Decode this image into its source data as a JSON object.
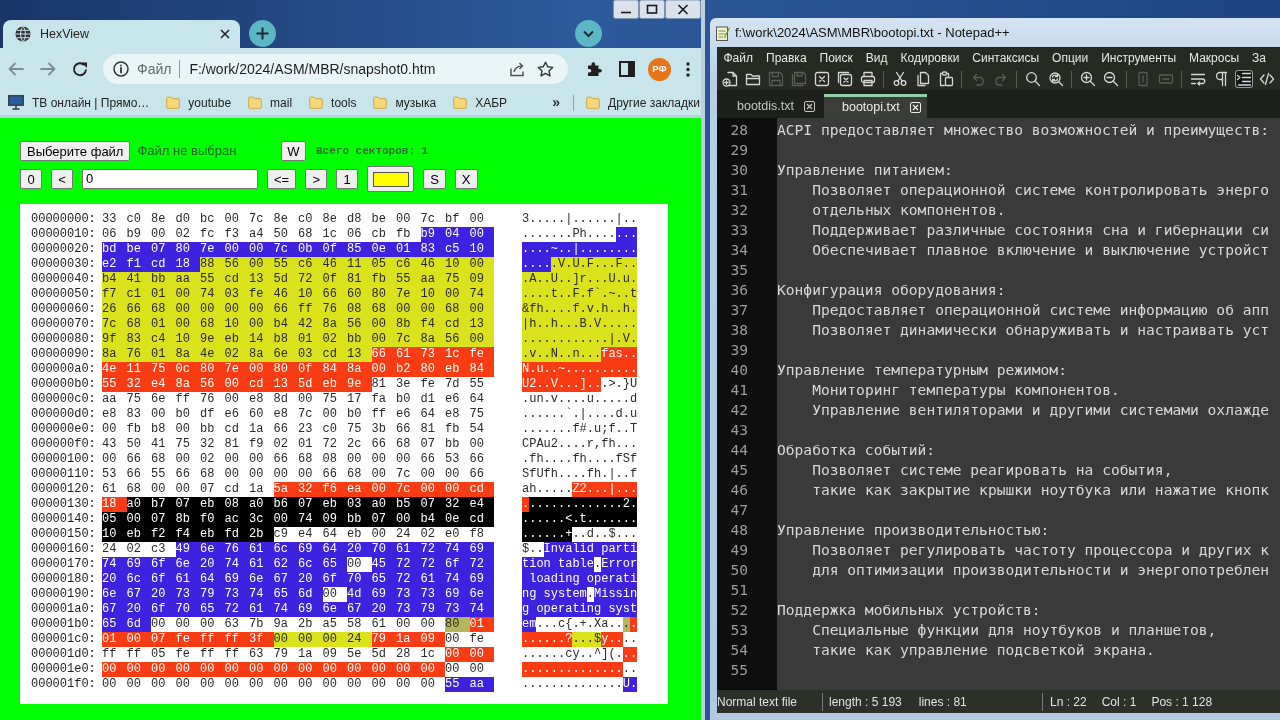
{
  "browser": {
    "tabs": [
      {
        "title": "HexView",
        "selected": true
      }
    ],
    "address_bar": {
      "scheme": "Файл",
      "url": "F:/work/2024/ASM/MBR/snapshot0.htm"
    },
    "profile": {
      "initials": "РФ"
    },
    "bookmarks": [
      {
        "kind": "site",
        "label": "ТВ онлайн | Прямо…"
      },
      {
        "kind": "folder",
        "label": "youtube"
      },
      {
        "kind": "folder",
        "label": "mail"
      },
      {
        "kind": "folder",
        "label": "tools"
      },
      {
        "kind": "folder",
        "label": "музыка"
      },
      {
        "kind": "folder",
        "label": "ХАБР"
      }
    ],
    "bookmarks_overflow": "»",
    "other_bookmarks": {
      "kind": "folder",
      "label": "Другие закладки"
    }
  },
  "hexview": {
    "file_button": "Выберите файл",
    "file_status": "Файл не выбран",
    "w_button": "W",
    "sector_count": "Всего секторов: 1",
    "controls": [
      {
        "kind": "button",
        "label": "0"
      },
      {
        "kind": "button",
        "label": "<"
      },
      {
        "kind": "input",
        "value": "0"
      },
      {
        "kind": "button",
        "label": "<="
      },
      {
        "kind": "button",
        "label": ">"
      },
      {
        "kind": "button",
        "label": "1"
      },
      {
        "kind": "color",
        "color": "#ffff00"
      },
      {
        "kind": "button",
        "label": "S"
      },
      {
        "kind": "button",
        "label": "X"
      }
    ],
    "dump": {
      "rows": [
        {
          "offset": "00000000:",
          "segments": [
            {
              "bytes": "33 c0 8e d0 bc 00 7c 8e c0 8e d8 be 00 7c bf 00",
              "color": "#ffffff"
            }
          ],
          "ascii": "3.....|......|.."
        },
        {
          "offset": "00000010:",
          "segments": [
            {
              "bytes": "06 b9 00 02 fc f3 a4 50 68 1c 06 cb fb",
              "color": "#ffffff"
            },
            {
              "bytes": "b9 04 00",
              "color": "#3d22e0"
            }
          ],
          "ascii": ".......Ph......."
        },
        {
          "offset": "00000020:",
          "segments": [
            {
              "bytes": "bd be 07 80 7e 00 00 7c 0b 0f 85 0e 01 83 c5 10",
              "color": "#3d22e0"
            }
          ],
          "ascii": "....~..|........"
        },
        {
          "offset": "00000030:",
          "segments": [
            {
              "bytes": "e2 f1 cd 18",
              "color": "#3d22e0"
            },
            {
              "bytes": "88 56 00 55 c6 46 11 05 c6 46 10 00",
              "color": "#dbe21c"
            }
          ],
          "ascii": ".....V.U.F...F.."
        },
        {
          "offset": "00000040:",
          "segments": [
            {
              "bytes": "b4 41 bb aa 55 cd 13 5d 72 0f 81 fb 55 aa 75 09",
              "color": "#dbe21c"
            }
          ],
          "ascii": ".A..U..]r...U.u."
        },
        {
          "offset": "00000050:",
          "segments": [
            {
              "bytes": "f7 c1 01 00 74 03 fe 46 10 66 60 80 7e 10 00 74",
              "color": "#dbe21c"
            }
          ],
          "ascii": "....t..F.f`.~..t"
        },
        {
          "offset": "00000060:",
          "segments": [
            {
              "bytes": "26 66 68 00 00 00 00 66 ff 76 08 68 00 00 68 00",
              "color": "#dbe21c"
            }
          ],
          "ascii": "&fh....f.v.h..h."
        },
        {
          "offset": "00000070:",
          "segments": [
            {
              "bytes": "7c 68 01 00 68 10 00 b4 42 8a 56 00 8b f4 cd 13",
              "color": "#dbe21c"
            }
          ],
          "ascii": "|h..h...B.V....."
        },
        {
          "offset": "00000080:",
          "segments": [
            {
              "bytes": "9f 83 c4 10 9e eb 14 b8 01 02 bb 00 7c 8a 56 00",
              "color": "#dbe21c"
            }
          ],
          "ascii": "............|.V."
        },
        {
          "offset": "00000090:",
          "segments": [
            {
              "bytes": "8a 76 01 8a 4e 02 8a 6e 03 cd 13",
              "color": "#dbe21c"
            },
            {
              "bytes": "66 61 73 1c fe",
              "color": "#fa3c14"
            }
          ],
          "ascii": ".v..N..n...fas.."
        },
        {
          "offset": "000000a0:",
          "segments": [
            {
              "bytes": "4e 11 75 0c 80 7e 00 80 0f 84 8a 00 b2 80 eb 84",
              "color": "#fa3c14"
            }
          ],
          "ascii": "N.u..~.........."
        },
        {
          "offset": "000000b0:",
          "segments": [
            {
              "bytes": "55 32 e4 8a 56 00 cd 13 5d eb 9e",
              "color": "#fa3c14"
            },
            {
              "bytes": "81 3e fe 7d 55",
              "color": "#ffffff"
            }
          ],
          "ascii": "U2..V...]...>.}U"
        },
        {
          "offset": "000000c0:",
          "segments": [
            {
              "bytes": "aa 75 6e ff 76 00 e8 8d 00 75 17 fa b0 d1 e6 64",
              "color": "#ffffff"
            }
          ],
          "ascii": ".un.v....u.....d"
        },
        {
          "offset": "000000d0:",
          "segments": [
            {
              "bytes": "e8 83 00 b0 df e6 60 e8 7c 00 b0 ff e6 64 e8 75",
              "color": "#ffffff"
            }
          ],
          "ascii": "......`.|....d.u"
        },
        {
          "offset": "000000e0:",
          "segments": [
            {
              "bytes": "00 fb b8 00 bb cd 1a 66 23 c0 75 3b 66 81 fb 54",
              "color": "#ffffff"
            }
          ],
          "ascii": ".......f#.u;f..T"
        },
        {
          "offset": "000000f0:",
          "segments": [
            {
              "bytes": "43 50 41 75 32 81 f9 02 01 72 2c 66 68 07 bb 00",
              "color": "#ffffff"
            }
          ],
          "ascii": "CPAu2....r,fh..."
        },
        {
          "offset": "00000100:",
          "segments": [
            {
              "bytes": "00 66 68 00 02 00 00 66 68 08 00 00 00 66 53 66",
              "color": "#ffffff"
            }
          ],
          "ascii": ".fh....fh....fSf"
        },
        {
          "offset": "00000110:",
          "segments": [
            {
              "bytes": "53 66 55 66 68 00 00 00 00 66 68 00 7c 00 00 66",
              "color": "#ffffff"
            }
          ],
          "ascii": "SfUfh....fh.|..f"
        },
        {
          "offset": "00000120:",
          "segments": [
            {
              "bytes": "61 68 00 00 07 cd 1a",
              "color": "#ffffff"
            },
            {
              "bytes": "5a 32 f6 ea 00 7c 00 00 cd",
              "color": "#fa3c14"
            }
          ],
          "ascii": "ah.....Z2...|..."
        },
        {
          "offset": "00000130:",
          "segments": [
            {
              "bytes": "18",
              "color": "#fa3c14"
            },
            {
              "bytes": "a0 b7 07 eb 08 a0 b6 07 eb 03 a0 b5 07 32 e4",
              "color": "#000000"
            }
          ],
          "ascii": "..............2."
        },
        {
          "offset": "00000140:",
          "segments": [
            {
              "bytes": "05 00 07 8b f0 ac 3c 00 74 09 bb 07 00 b4 0e cd",
              "color": "#000000"
            }
          ],
          "ascii": "......<.t......."
        },
        {
          "offset": "00000150:",
          "segments": [
            {
              "bytes": "10 eb f2 f4 eb fd 2b",
              "color": "#000000"
            },
            {
              "bytes": "c9 e4 64 eb 00 24 02 e0 f8",
              "color": "#ffffff"
            }
          ],
          "ascii": "......+..d..$..."
        },
        {
          "offset": "00000160:",
          "segments": [
            {
              "bytes": "24 02 c3",
              "color": "#ffffff"
            },
            {
              "bytes": "49 6e 76 61 6c 69 64 20 70 61 72 74 69",
              "color": "#3d22e0"
            }
          ],
          "ascii": "$..Invalid parti"
        },
        {
          "offset": "00000170:",
          "segments": [
            {
              "bytes": "74 69 6f 6e 20 74 61 62 6c 65",
              "color": "#3d22e0"
            },
            {
              "bytes": "00",
              "color": "#ffffff"
            },
            {
              "bytes": "45 72 72 6f 72",
              "color": "#3d22e0"
            }
          ],
          "ascii": "tion table.Error"
        },
        {
          "offset": "00000180:",
          "segments": [
            {
              "bytes": "20 6c 6f 61 64 69 6e 67 20 6f 70 65 72 61 74 69",
              "color": "#3d22e0"
            }
          ],
          "ascii": " loading operati"
        },
        {
          "offset": "00000190:",
          "segments": [
            {
              "bytes": "6e 67 20 73 79 73 74 65 6d",
              "color": "#3d22e0"
            },
            {
              "bytes": "00",
              "color": "#ffffff"
            },
            {
              "bytes": "4d 69 73 73 69 6e",
              "color": "#3d22e0"
            }
          ],
          "ascii": "ng system.Missin"
        },
        {
          "offset": "000001a0:",
          "segments": [
            {
              "bytes": "67 20 6f 70 65 72 61 74 69 6e 67 20 73 79 73 74",
              "color": "#3d22e0"
            }
          ],
          "ascii": "g operating syst"
        },
        {
          "offset": "000001b0:",
          "segments": [
            {
              "bytes": "65 6d",
              "color": "#3d22e0"
            },
            {
              "bytes": "00 00 00 63 7b 9a 2b a5 58 61 00 00",
              "color": "#ffffff"
            },
            {
              "bytes": "80",
              "color": "#b4b65a"
            },
            {
              "bytes": "01",
              "color": "#fa3c14"
            }
          ],
          "ascii": "em...c{.+.Xa...."
        },
        {
          "offset": "000001c0:",
          "segments": [
            {
              "bytes": "01 00 07 fe ff ff 3f",
              "color": "#fa3c14"
            },
            {
              "bytes": "00 00 00 24",
              "color": "#dbe21c"
            },
            {
              "bytes": "79 1a 09",
              "color": "#fa3c14"
            },
            {
              "bytes": "00 fe",
              "color": "#ffffff"
            }
          ],
          "ascii": "......?...$y...."
        },
        {
          "offset": "000001d0:",
          "segments": [
            {
              "bytes": "ff ff 05 fe ff ff 63 79 1a 09 5e 5d 28 1c",
              "color": "#ffffff"
            },
            {
              "bytes": "00 00",
              "color": "#fa3c14"
            }
          ],
          "ascii": "......cy..^](..."
        },
        {
          "offset": "000001e0:",
          "segments": [
            {
              "bytes": "00 00 00 00 00 00 00 00 00 00 00 00 00 00",
              "color": "#fa3c14"
            },
            {
              "bytes": "00 00",
              "color": "#ffffff"
            }
          ],
          "ascii": "................"
        },
        {
          "offset": "000001f0:",
          "segments": [
            {
              "bytes": "00 00 00 00 00 00 00 00 00 00 00 00 00 00",
              "color": "#ffffff"
            },
            {
              "bytes": "55 aa",
              "color": "#3d22e0"
            }
          ],
          "ascii": "..............U."
        }
      ]
    }
  },
  "notepad": {
    "title": "f:\\work\\2024\\ASM\\MBR\\bootopi.txt - Notepad++",
    "menu": [
      "Файл",
      "Правка",
      "Поиск",
      "Вид",
      "Кодировки",
      "Синтаксисы",
      "Опции",
      "Инструменты",
      "Макросы",
      "За"
    ],
    "toolbar_groups": [
      {
        "buttons": [
          {
            "kind": "new",
            "disabled": false,
            "on": false
          },
          {
            "kind": "open",
            "disabled": false,
            "on": false
          },
          {
            "kind": "save",
            "disabled": true,
            "on": false
          },
          {
            "kind": "saveall",
            "disabled": true,
            "on": false
          },
          {
            "kind": "close",
            "disabled": false,
            "on": false
          },
          {
            "kind": "closeall",
            "disabled": false,
            "on": false
          },
          {
            "kind": "print",
            "disabled": false,
            "on": false
          }
        ]
      },
      {
        "buttons": [
          {
            "kind": "cut",
            "disabled": false,
            "on": false
          },
          {
            "kind": "copy",
            "disabled": false,
            "on": false
          },
          {
            "kind": "paste",
            "disabled": false,
            "on": false
          }
        ]
      },
      {
        "buttons": [
          {
            "kind": "undo",
            "disabled": true,
            "on": false
          },
          {
            "kind": "redo",
            "disabled": true,
            "on": false
          }
        ]
      },
      {
        "buttons": [
          {
            "kind": "find",
            "disabled": false,
            "on": false
          },
          {
            "kind": "replace",
            "disabled": false,
            "on": false
          }
        ]
      },
      {
        "buttons": [
          {
            "kind": "zoomin",
            "disabled": false,
            "on": false
          },
          {
            "kind": "zoomout",
            "disabled": false,
            "on": false
          }
        ]
      },
      {
        "buttons": [
          {
            "kind": "syncv",
            "disabled": true,
            "on": false
          },
          {
            "kind": "synch",
            "disabled": true,
            "on": false
          }
        ]
      },
      {
        "buttons": [
          {
            "kind": "wrap",
            "disabled": false,
            "on": false
          },
          {
            "kind": "pilcrow",
            "disabled": false,
            "on": false
          },
          {
            "kind": "indentguide",
            "disabled": false,
            "on": true
          },
          {
            "kind": "xml",
            "disabled": false,
            "on": false
          }
        ]
      }
    ],
    "tabs": [
      {
        "label": "bootdis.txt",
        "selected": false
      },
      {
        "label": "bootopi.txt",
        "selected": true
      }
    ],
    "lines": [
      {
        "number": "28",
        "kind": "plain",
        "text": "ACPI предоставляет множество возможностей и преимуществ:"
      },
      {
        "number": "29"
      },
      {
        "number": "30",
        "kind": "plain",
        "text": "Управление питанием:"
      },
      {
        "number": "31",
        "kind": "indented",
        "text": "Позволяет операционной системе контролировать энерго"
      },
      {
        "number": "32",
        "kind": "indented",
        "text": "отдельных компонентов."
      },
      {
        "number": "33",
        "kind": "indented",
        "text": "Поддерживает различные состояния сна и гибернации си"
      },
      {
        "number": "34",
        "kind": "indented",
        "text": "Обеспечивает плавное включение и выключение устройст"
      },
      {
        "number": "35"
      },
      {
        "number": "36",
        "kind": "plain",
        "text": "Конфигурация оборудования:"
      },
      {
        "number": "37",
        "kind": "indented",
        "text": "Предоставляет операционной системе информацию об апп"
      },
      {
        "number": "38",
        "kind": "indented",
        "text": "Позволяет динамически обнаруживать и настраивать уст"
      },
      {
        "number": "39"
      },
      {
        "number": "40",
        "kind": "plain",
        "text": "Управление температурным режимом:"
      },
      {
        "number": "41",
        "kind": "indented",
        "text": "Мониторинг температуры компонентов."
      },
      {
        "number": "42",
        "kind": "indented",
        "text": "Управление вентиляторами и другими системами охлажде"
      },
      {
        "number": "43"
      },
      {
        "number": "44",
        "kind": "plain",
        "text": "Обработка событий:"
      },
      {
        "number": "45",
        "kind": "indented",
        "text": "Позволяет системе реагировать на события,"
      },
      {
        "number": "46",
        "kind": "indented",
        "text": "такие как закрытие крышки ноутбука или нажатие кнопк"
      },
      {
        "number": "47"
      },
      {
        "number": "48",
        "kind": "plain",
        "text": "Управление производительностью:"
      },
      {
        "number": "49",
        "kind": "indented",
        "text": "Позволяет регулировать частоту процессора и других к"
      },
      {
        "number": "50",
        "kind": "indented",
        "text": "для оптимизации производительности и энергопотреблен"
      },
      {
        "number": "51"
      },
      {
        "number": "52",
        "kind": "plain",
        "text": "Поддержка мобильных устройств:"
      },
      {
        "number": "53",
        "kind": "indented",
        "text": "Специальные функции для ноутбуков и планшетов,"
      },
      {
        "number": "54",
        "kind": "indented",
        "text": "такие как управление подсветкой экрана."
      },
      {
        "number": "55"
      }
    ],
    "status_bar": {
      "file_type": "Normal text file",
      "length": "length : 5 193",
      "lines": "lines : 81",
      "ln": "Ln : 22",
      "col": "Col : 1",
      "pos": "Pos : 1 128"
    }
  }
}
